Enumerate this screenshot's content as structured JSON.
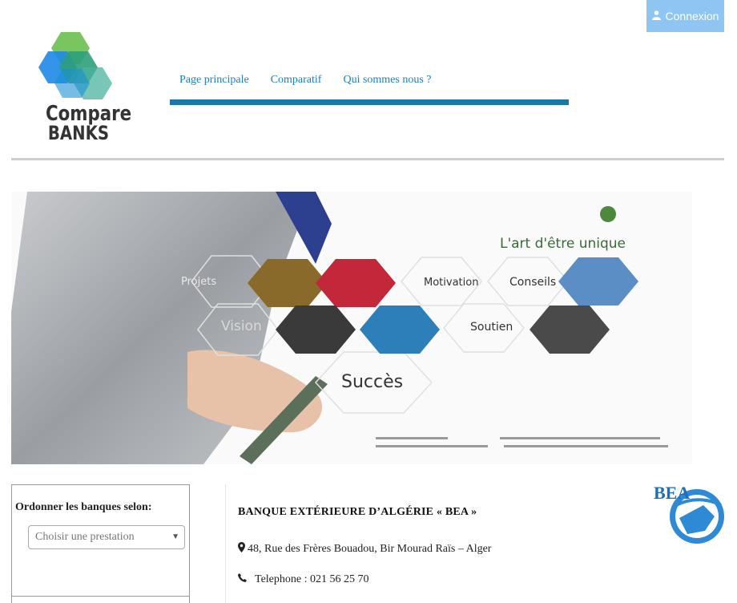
{
  "header": {
    "login_label": "Connexion",
    "login_icon": "user-icon",
    "logo": {
      "line1": "Compare",
      "line2": "BANKS"
    },
    "nav": [
      {
        "label": "Page principale"
      },
      {
        "label": "Comparatif"
      },
      {
        "label": "Qui sommes nous ?"
      }
    ],
    "accent_color": "#1b77a8"
  },
  "banner": {
    "tagline": "L'art d'être unique",
    "words": [
      "Projets",
      "Motivation",
      "Conseils",
      "Vision",
      "Soutien",
      "Succès"
    ]
  },
  "sidebar": {
    "sort_label": "Ordonner les banques selon:",
    "select_placeholder": "Choisir une prestation"
  },
  "bank": {
    "name": "BANQUE EXTÉRIEURE D’ALGÉRIE « BEA »",
    "address": "48, Rue des Frères Bouadou, Bir Mourad Raïs – Alger",
    "phone": "Telephone : 021 56 25 70",
    "logo_text": "BEA"
  }
}
